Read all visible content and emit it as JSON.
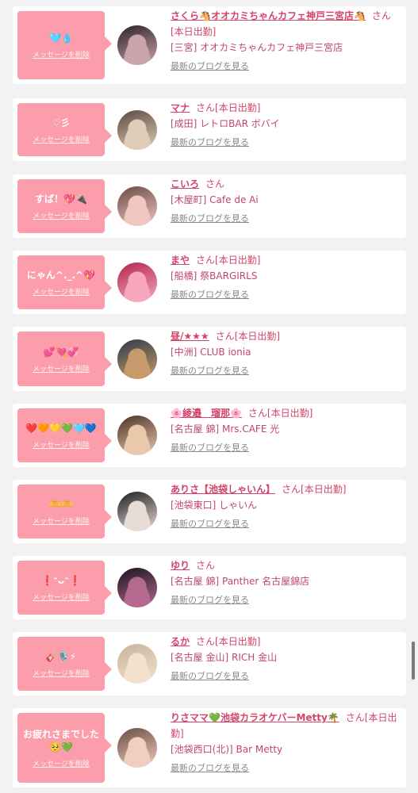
{
  "delete_label": "メッセージを削除",
  "blog_label": "最新のブログを見る",
  "colors": {
    "bubble": "#fb9daa",
    "name": "#d4436a",
    "card": "#ffffff",
    "background": "#f2f2f2"
  },
  "messages": [
    {
      "bubble_lines": [
        "🩵💧"
      ],
      "name": "さくら🐴オオカミちゃんカフェ神戸三宮店🐴",
      "suffix": "さん[本日出勤]",
      "shop": "[三宮] オオカミちゃんカフェ神戸三宮店",
      "avatar_icon": "profile-photo-icon",
      "avatar_colors": [
        "#2b2326",
        "#c9a4ad"
      ]
    },
    {
      "bubble_lines": [
        "♡彡"
      ],
      "name": "マナ",
      "suffix": "さん[本日出勤]",
      "shop": "[成田] レトロBAR ボバイ",
      "avatar_icon": "profile-photo-icon",
      "avatar_colors": [
        "#5a4a3f",
        "#e0cdb9"
      ]
    },
    {
      "bubble_lines": [
        "すば！💖🔌"
      ],
      "name": "こいろ",
      "suffix": "さん",
      "shop": "[木屋町] Cafe de Ai",
      "avatar_icon": "profile-photo-icon",
      "avatar_colors": [
        "#6b4a44",
        "#f1c6c1"
      ]
    },
    {
      "bubble_lines": [
        "にゃん^._.^💖"
      ],
      "name": "まや",
      "suffix": "さん[本日出勤]",
      "shop": "[船橋] 祭BARGIRLS",
      "avatar_icon": "profile-photo-icon",
      "avatar_colors": [
        "#b4264d",
        "#f6a6bd"
      ]
    },
    {
      "bubble_lines": [
        "💕💘💞"
      ],
      "name": "昼/★★★",
      "suffix": "さん[本日出勤]",
      "shop": "[中洲] CLUB ionia",
      "avatar_icon": "profile-photo-icon",
      "avatar_colors": [
        "#2f3a4a",
        "#c79a6b"
      ]
    },
    {
      "bubble_lines": [
        "❤️🧡💛💚🩵💙"
      ],
      "name": "🌸綾邉　瑠那🌸",
      "suffix": "さん[本日出勤]",
      "shop": "[名古屋 錦] Mrs.CAFE 光",
      "avatar_icon": "profile-photo-icon",
      "avatar_colors": [
        "#4a3326",
        "#e9c8ac"
      ]
    },
    {
      "bubble_lines": [
        "🫶🫶"
      ],
      "name": "ありさ【池袋しゃいん】",
      "suffix": "さん[本日出勤]",
      "shop": "[池袋東口] しゃいん",
      "avatar_icon": "profile-photo-icon",
      "avatar_colors": [
        "#1e1e22",
        "#e8dcd6"
      ]
    },
    {
      "bubble_lines": [
        "❗️ᵔᴗᵔ❗️"
      ],
      "name": "ゆり",
      "suffix": "さん",
      "shop": "[名古屋 錦] Panther 名古屋錦店",
      "avatar_icon": "profile-photo-icon",
      "avatar_colors": [
        "#1a1320",
        "#b36a8e"
      ]
    },
    {
      "bubble_lines": [
        "🎸🎙️⚡"
      ],
      "name": "るか",
      "suffix": "さん[本日出勤]",
      "shop": "[名古屋 金山] RICH 金山",
      "avatar_icon": "profile-photo-icon",
      "avatar_colors": [
        "#c9b49b",
        "#f4e2cf"
      ]
    },
    {
      "bubble_lines": [
        "お疲れさまでした",
        "🥺💚"
      ],
      "name": "りさママ💚池袋カラオケバーMetty🌴",
      "suffix": "さん[本日出勤]",
      "shop": "[池袋西口(北)] Bar Metty",
      "avatar_icon": "profile-photo-icon",
      "avatar_colors": [
        "#6a4c42",
        "#f1cfc0"
      ]
    }
  ]
}
